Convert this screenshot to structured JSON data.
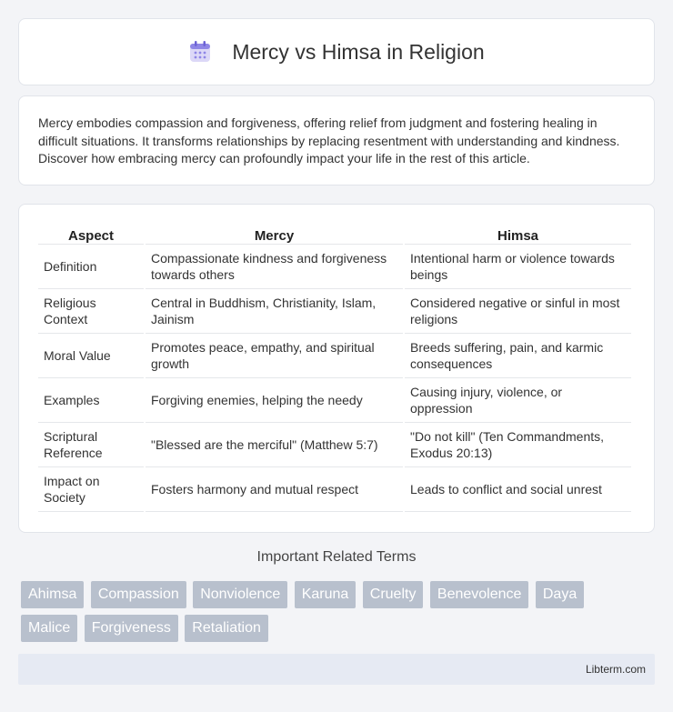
{
  "header": {
    "title": "Mercy vs Himsa in Religion",
    "icon": "calendar-icon"
  },
  "intro": {
    "text": "Mercy embodies compassion and forgiveness, offering relief from judgment and fostering healing in difficult situations. It transforms relationships by replacing resentment with understanding and kindness. Discover how embracing mercy can profoundly impact your life in the rest of this article."
  },
  "table": {
    "headers": [
      "Aspect",
      "Mercy",
      "Himsa"
    ],
    "rows": [
      [
        "Definition",
        "Compassionate kindness and forgiveness towards others",
        "Intentional harm or violence towards beings"
      ],
      [
        "Religious Context",
        "Central in Buddhism, Christianity, Islam, Jainism",
        "Considered negative or sinful in most religions"
      ],
      [
        "Moral Value",
        "Promotes peace, empathy, and spiritual growth",
        "Breeds suffering, pain, and karmic consequences"
      ],
      [
        "Examples",
        "Forgiving enemies, helping the needy",
        "Causing injury, violence, or oppression"
      ],
      [
        "Scriptural Reference",
        "\"Blessed are the merciful\" (Matthew 5:7)",
        "\"Do not kill\" (Ten Commandments, Exodus 20:13)"
      ],
      [
        "Impact on Society",
        "Fosters harmony and mutual respect",
        "Leads to conflict and social unrest"
      ]
    ]
  },
  "related": {
    "title": "Important Related Terms",
    "tags": [
      "Ahimsa",
      "Compassion",
      "Nonviolence",
      "Karuna",
      "Cruelty",
      "Benevolence",
      "Daya",
      "Malice",
      "Forgiveness",
      "Retaliation"
    ]
  },
  "footer": {
    "site": "Libterm.com"
  }
}
